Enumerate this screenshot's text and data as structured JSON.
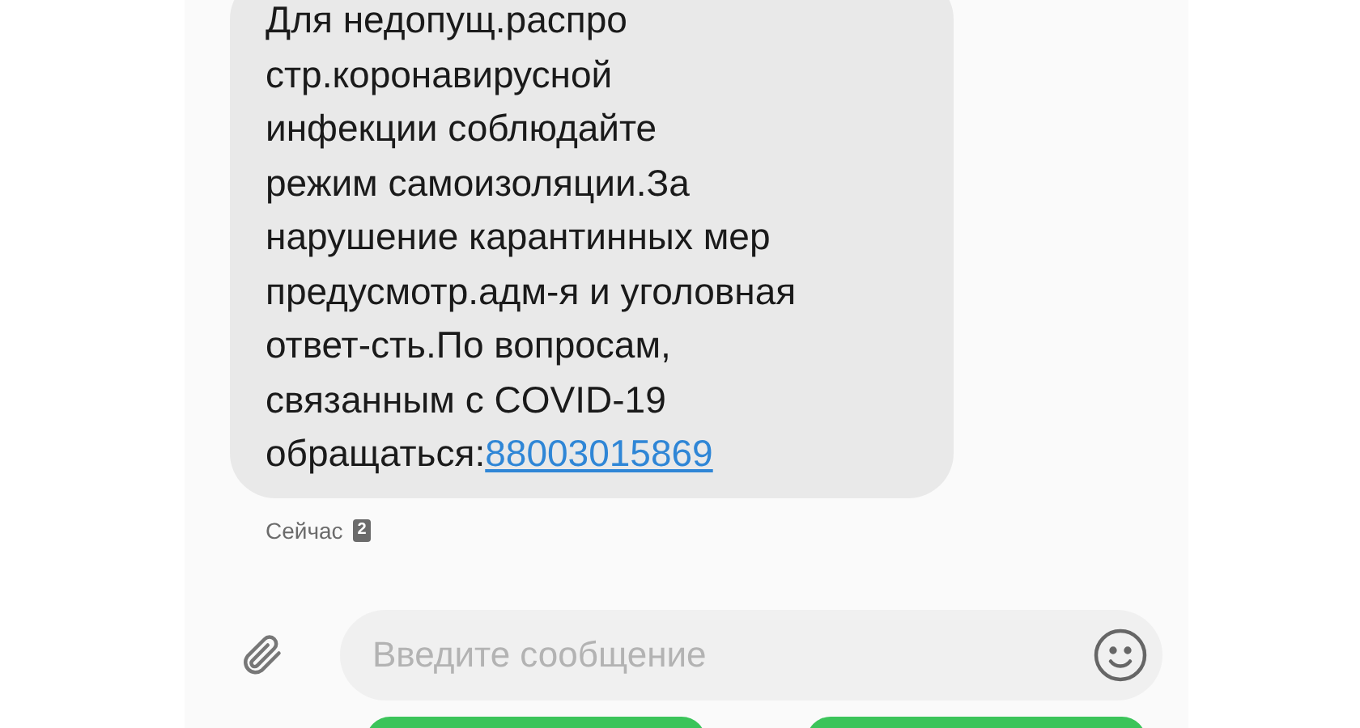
{
  "message": {
    "text": "Для недопущ.распро\nстр.коронавирусной\nинфекции соблюдайте\nрежим самоизоляции.За\nнарушение карантинных мер\nпредусмотр.адм-я и уголовная\nответ-сть.По вопросам,\nсвязанным с COVID-19\nобращаться:",
    "link": "88003015869",
    "time": "Сейчас",
    "sim": "2"
  },
  "composer": {
    "placeholder": "Введите сообщение"
  }
}
